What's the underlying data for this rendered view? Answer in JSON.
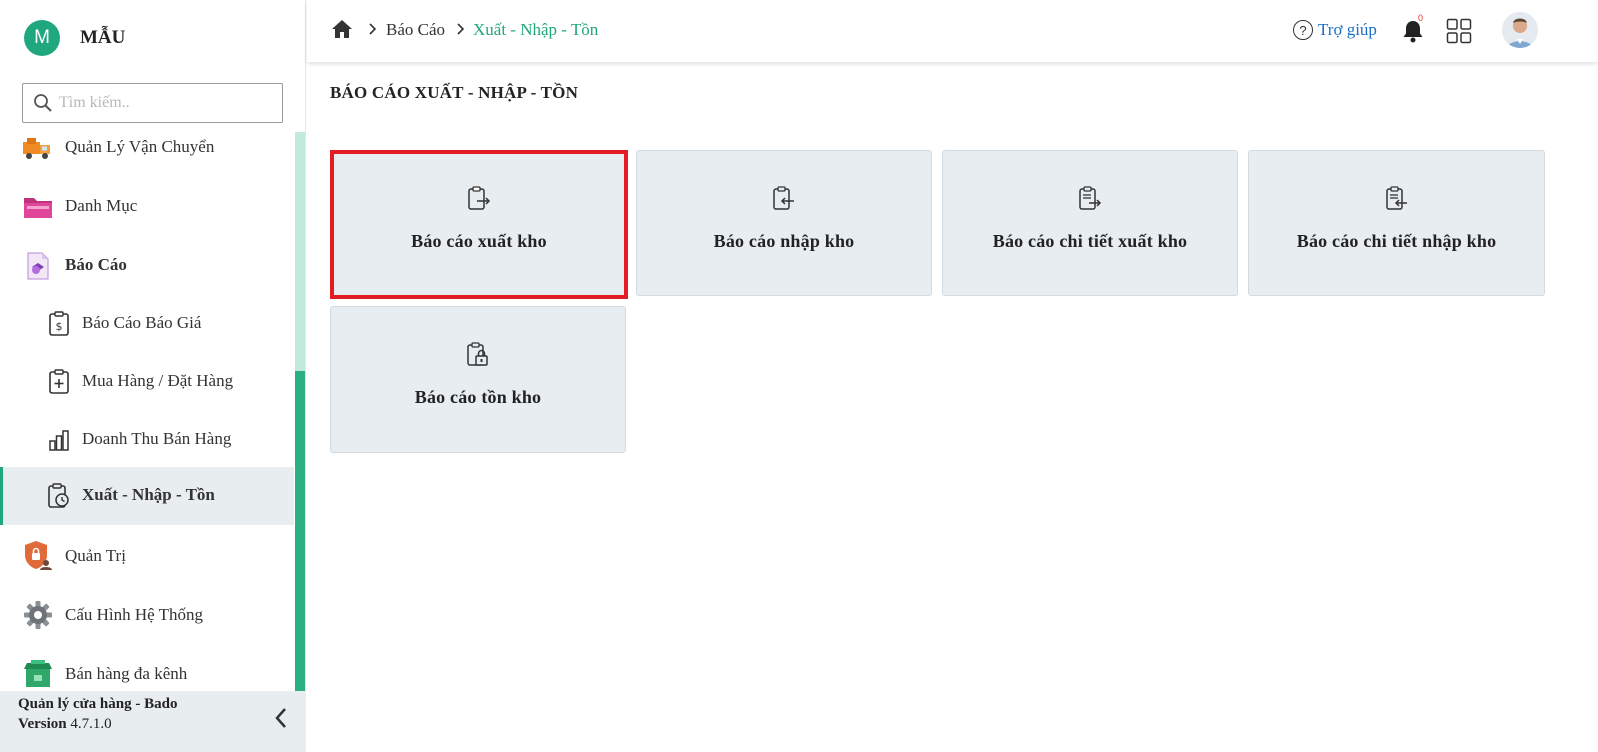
{
  "brand": {
    "initial": "M",
    "name": "MẪU"
  },
  "search": {
    "placeholder": "Tìm kiếm.."
  },
  "sidebar": {
    "items": [
      {
        "label": "Quản Lý Vận Chuyển",
        "icon": "truck-icon"
      },
      {
        "label": "Danh Mục",
        "icon": "folder-icon"
      },
      {
        "label": "Báo Cáo",
        "icon": "report-icon"
      },
      {
        "label": "Báo Cáo Báo Giá",
        "icon": "clipboard-dollar-icon"
      },
      {
        "label": "Mua Hàng / Đặt Hàng",
        "icon": "clipboard-plus-icon"
      },
      {
        "label": "Doanh Thu Bán Hàng",
        "icon": "bar-chart-icon"
      },
      {
        "label": "Xuất - Nhập - Tồn",
        "icon": "clipboard-clock-icon"
      },
      {
        "label": "Quản Trị",
        "icon": "shield-user-icon"
      },
      {
        "label": "Cấu Hình Hệ Thống",
        "icon": "gear-icon"
      },
      {
        "label": "Bán hàng đa kênh",
        "icon": "store-icon"
      }
    ],
    "active_item": "Xuất - Nhập - Tồn",
    "footer": {
      "app_name": "Quản lý cửa hàng - Bado",
      "version_label": "Version",
      "version": "4.7.1.0"
    }
  },
  "header": {
    "breadcrumb": [
      "Báo Cáo",
      "Xuất - Nhập - Tồn"
    ],
    "help_label": "Trợ giúp",
    "notification_count": "0"
  },
  "page": {
    "title": "BÁO CÁO XUẤT - NHẬP - TỒN",
    "cards": [
      {
        "label": "Báo cáo xuất kho",
        "icon": "clipboard-export-icon",
        "selected": true
      },
      {
        "label": "Báo cáo nhập kho",
        "icon": "clipboard-import-icon"
      },
      {
        "label": "Báo cáo chi tiết xuất kho",
        "icon": "clipboard-list-export-icon"
      },
      {
        "label": "Báo cáo chi tiết nhập kho",
        "icon": "clipboard-list-import-icon"
      },
      {
        "label": "Báo cáo tồn kho",
        "icon": "clipboard-lock-icon"
      }
    ]
  },
  "colors": {
    "accent": "#21a77d",
    "link": "#1a6fc9",
    "selected_border": "#e11d23",
    "card_bg": "#e8edf1"
  }
}
